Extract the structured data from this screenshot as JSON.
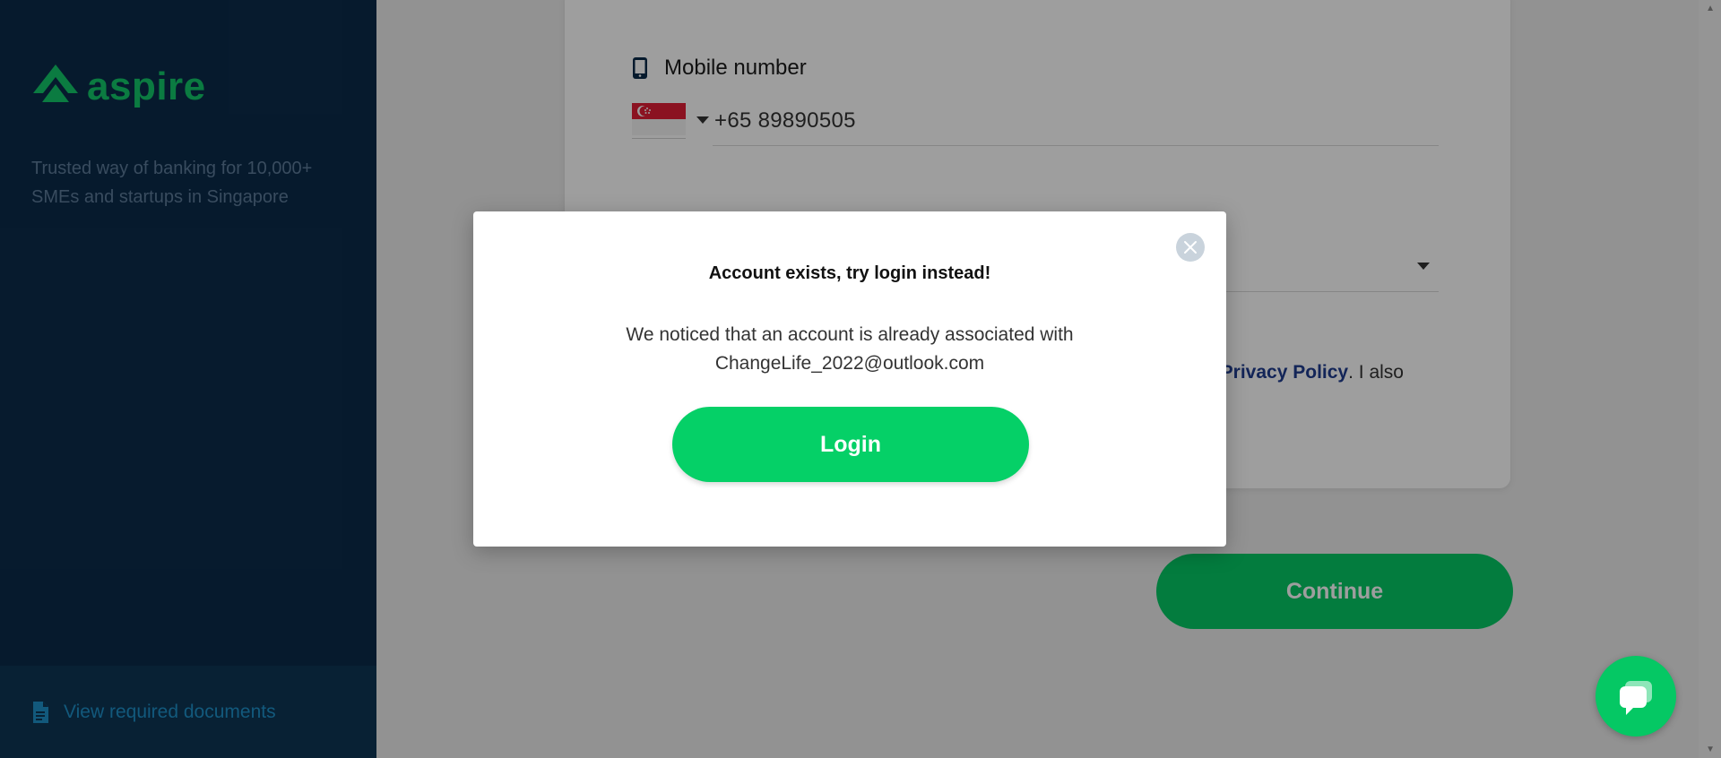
{
  "sidebar": {
    "logo_text": "aspire",
    "tagline": "Trusted way of banking for 10,000+ SMEs and startups in Singapore",
    "docs_link": "View required documents"
  },
  "form": {
    "mobile_label": "Mobile number",
    "country_flag": "Singapore",
    "phone_value": "+65 89890505",
    "terms_fragment_1": ", ",
    "terms_link": "Privacy Policy",
    "terms_fragment_2": ". I also",
    "continue_label": "Continue"
  },
  "modal": {
    "title": "Account exists, try login instead!",
    "body_line1": "We noticed that an account is already associated with",
    "body_line2": "ChangeLife_2022@outlook.com",
    "login_label": "Login"
  },
  "icons": {
    "phone": "mobile-phone-icon",
    "document": "document-icon",
    "close": "close-icon",
    "chat": "chat-icon"
  },
  "colors": {
    "brand_green": "#05c864",
    "sidebar_bg": "#0b2b4a",
    "link_blue": "#1f3c8f"
  }
}
